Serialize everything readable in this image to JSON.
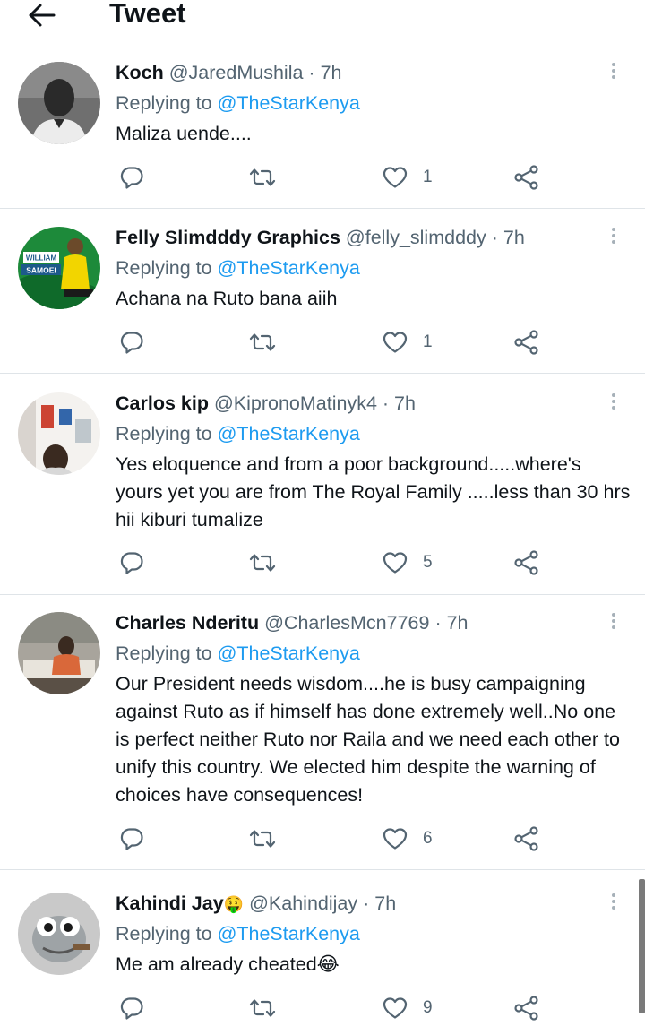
{
  "header": {
    "title": "Tweet",
    "back_icon": "arrow-left-icon"
  },
  "colors": {
    "link": "#1d9bf0",
    "secondary": "#536471",
    "text": "#0f1419",
    "divider": "#dfe4e8"
  },
  "tweets": [
    {
      "display_name": "Koch",
      "emoji": "",
      "handle": "@JaredMushila",
      "time": "7h",
      "replying_label": "Replying to",
      "replying_to": "@TheStarKenya",
      "text": "Maliza uende....",
      "likes": "1"
    },
    {
      "display_name": "Felly Slimdddy Graphics",
      "emoji": "",
      "handle": "@felly_slimdddy",
      "time": "7h",
      "replying_label": "Replying to",
      "replying_to": "@TheStarKenya",
      "text": "Achana na Ruto bana aiih",
      "likes": "1",
      "avatar_text": [
        "WILLIAM",
        "SAMOEI"
      ]
    },
    {
      "display_name": "Carlos kip",
      "emoji": "",
      "handle": "@KipronoMatinyk4",
      "time": "7h",
      "replying_label": "Replying to",
      "replying_to": "@TheStarKenya",
      "text": "Yes eloquence and from  a poor background.....where's yours yet you are from The Royal Family .....less than 30 hrs hii kiburi tumalize",
      "likes": "5"
    },
    {
      "display_name": "Charles Nderitu",
      "emoji": "",
      "handle": "@CharlesMcn7769",
      "time": "7h",
      "replying_label": "Replying to",
      "replying_to": "@TheStarKenya",
      "text": "Our President needs wisdom....he is busy campaigning against Ruto as if himself has done extremely well..No one is perfect neither Ruto nor Raila and we need each other to unify this country. We elected him despite the warning of choices have consequences!",
      "likes": "6"
    },
    {
      "display_name": "Kahindi Jay",
      "emoji": "🤑",
      "handle": "@Kahindijay",
      "time": "7h",
      "replying_label": "Replying to",
      "replying_to": "@TheStarKenya",
      "text": "Me am already cheated😂",
      "likes": "9"
    }
  ]
}
